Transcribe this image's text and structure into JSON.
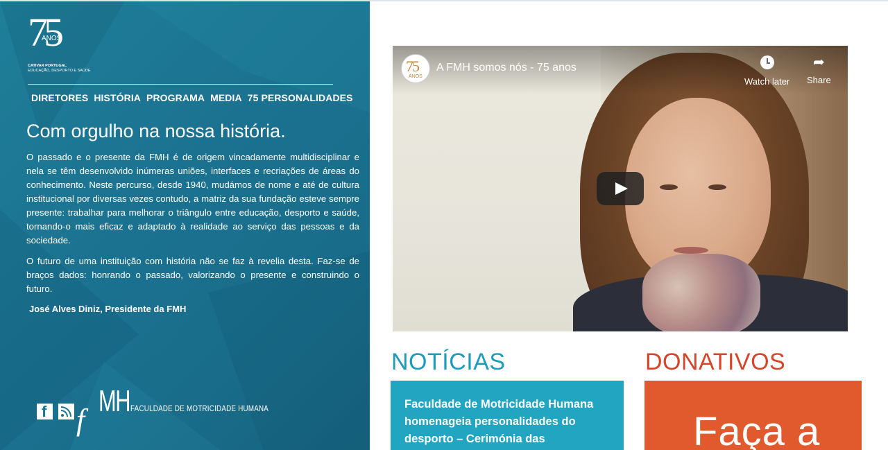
{
  "logo": {
    "number": "75",
    "anos": "ANOS",
    "tagline1": "CATIVAR PORTUGAL",
    "tagline2": "EDUCAÇÃO, DESPORTO E SAÚDE"
  },
  "nav": [
    {
      "label": "DIRETORES"
    },
    {
      "label": "HISTÓRIA"
    },
    {
      "label": "PROGRAMA"
    },
    {
      "label": "MEDIA"
    },
    {
      "label": "75 PERSONALIDADES"
    }
  ],
  "headline": "Com orgulho na nossa história.",
  "paragraphs": [
    "O passado e o presente da FMH é de origem vincadamente multidisciplinar e nela se têm desenvolvido inúmeras uniões, interfaces e recriações de áreas do conhecimento. Neste percurso, desde 1940, mudámos de nome e até de cultura institucional por diversas vezes contudo, a matriz da sua fundação esteve sempre presente: trabalhar para melhorar o triângulo entre educação, desporto e saúde, tornando-o mais eficaz e adaptado à realidade ao serviço das pessoas e da sociedade.",
    "O futuro de uma instituição com história não se faz à revelia desta. Faz-se de braços dados: honrando o passado, valorizando o presente e construindo o futuro."
  ],
  "signature": "José Alves Diniz, Presidente da FMH",
  "footer_logo": {
    "f": "f",
    "mh": "MH",
    "name": "Faculdade de Motricidade Humana"
  },
  "video": {
    "channel_logo_number": "75",
    "channel_logo_anos": "ANOS",
    "title": "A FMH somos nós - 75 anos",
    "watch_later": "Watch later",
    "share": "Share"
  },
  "news": {
    "title": "NOTÍCIAS",
    "card_text": "Faculdade de Motricidade Humana homenageia personalidades do desporto – Cerimónia das"
  },
  "donations": {
    "title": "DONATIVOS",
    "card_text": "Faça a"
  },
  "colors": {
    "panel": "#1b7391",
    "news_accent": "#1d9bba",
    "donation_accent": "#d4452a"
  }
}
